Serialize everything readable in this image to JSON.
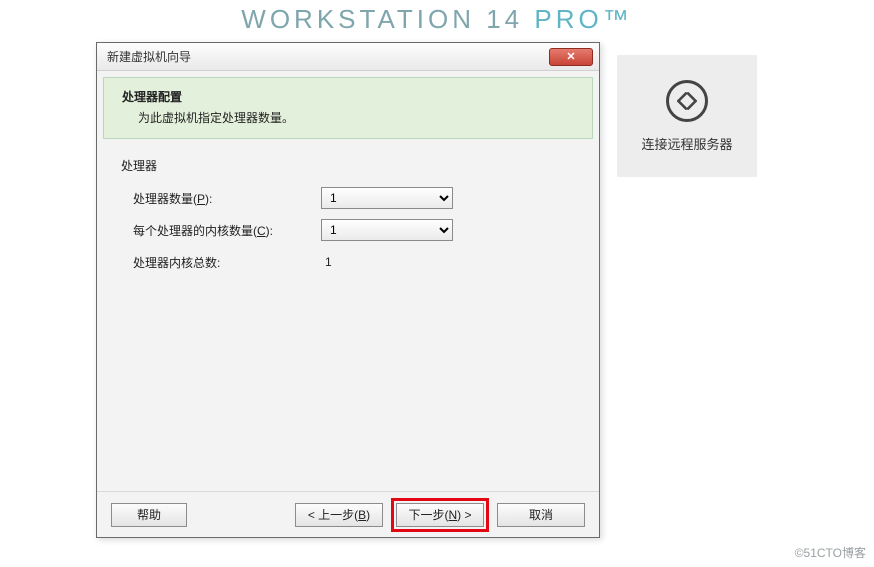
{
  "app": {
    "title_main": "WORKSTATION 14 ",
    "title_pro": "PRO™"
  },
  "server_tile": {
    "label": "连接远程服务器",
    "icon": "connect-remote-icon"
  },
  "watermark": "©51CTO博客",
  "dialog": {
    "title": "新建虚拟机向导",
    "header": {
      "title": "处理器配置",
      "subtitle": "为此虚拟机指定处理器数量。"
    },
    "section_label": "处理器",
    "rows": {
      "proc_count": {
        "label_pre": "处理器数量(",
        "hotkey": "P",
        "label_post": "):",
        "value": "1"
      },
      "cores_per": {
        "label_pre": "每个处理器的内核数量(",
        "hotkey": "C",
        "label_post": "):",
        "value": "1"
      },
      "total": {
        "label": "处理器内核总数:",
        "value": "1"
      }
    },
    "buttons": {
      "help": "帮助",
      "back_pre": "< 上一步(",
      "back_hot": "B",
      "back_post": ")",
      "next_pre": "下一步(",
      "next_hot": "N",
      "next_post": ") >",
      "cancel": "取消"
    }
  }
}
